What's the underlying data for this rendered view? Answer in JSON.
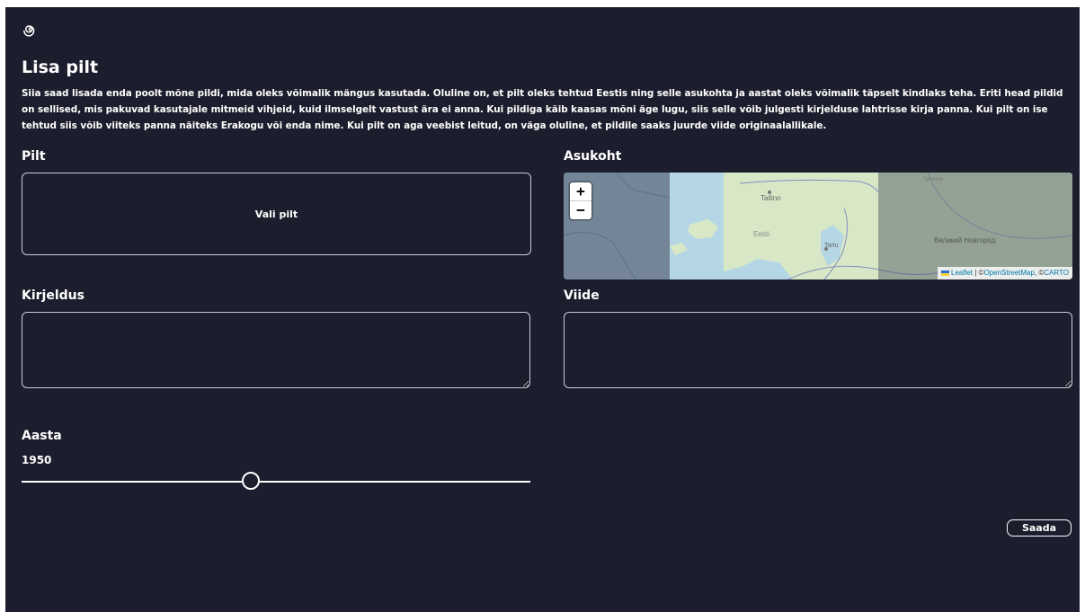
{
  "page": {
    "logo_icon": "spiral-logo-icon",
    "title": "Lisa pilt",
    "description": "Siia saad lisada enda poolt mõne pildi, mida oleks võimalik mängus kasutada. Oluline on, et pilt oleks tehtud Eestis ning selle asukohta ja aastat oleks võimalik täpselt kindlaks teha. Eriti head pildid on sellised, mis pakuvad kasutajale mitmeid vihjeid, kuid ilmselgelt vastust ära ei anna. Kui pildiga käib kaasas mõni äge lugu, siis selle võib julgesti kirjelduse lahtrisse kirja panna. Kui pilt on ise tehtud siis võib viiteks panna näiteks Erakogu või enda nime. Kui pilt on aga veebist leitud, on väga oluline, et pildile saaks juurde viide originaalallikale."
  },
  "picture": {
    "label": "Pilt",
    "button": "Vali pilt"
  },
  "location": {
    "label": "Asukoht",
    "zoom_in": "+",
    "zoom_out": "−",
    "places": {
      "tallinn": "Tallinn",
      "eesti": "Eesti",
      "tartu": "Tartu",
      "novgorod": "Великий Новгород",
      "gatchina": "Гатчина"
    },
    "attribution": {
      "leaflet": "Leaflet",
      "sep": " | ©",
      "osm": "OpenStreetMap",
      "sep2": ", ©",
      "carto": "CARTO"
    }
  },
  "description_field": {
    "label": "Kirjeldus",
    "value": ""
  },
  "source_field": {
    "label": "Viide",
    "value": ""
  },
  "year": {
    "label": "Aasta",
    "value": "1950",
    "slider_fraction": 0.45
  },
  "submit": {
    "label": "Saada"
  },
  "colors": {
    "background": "#1d1e2d",
    "text": "#ffffff",
    "border": "#c9ccd8"
  }
}
